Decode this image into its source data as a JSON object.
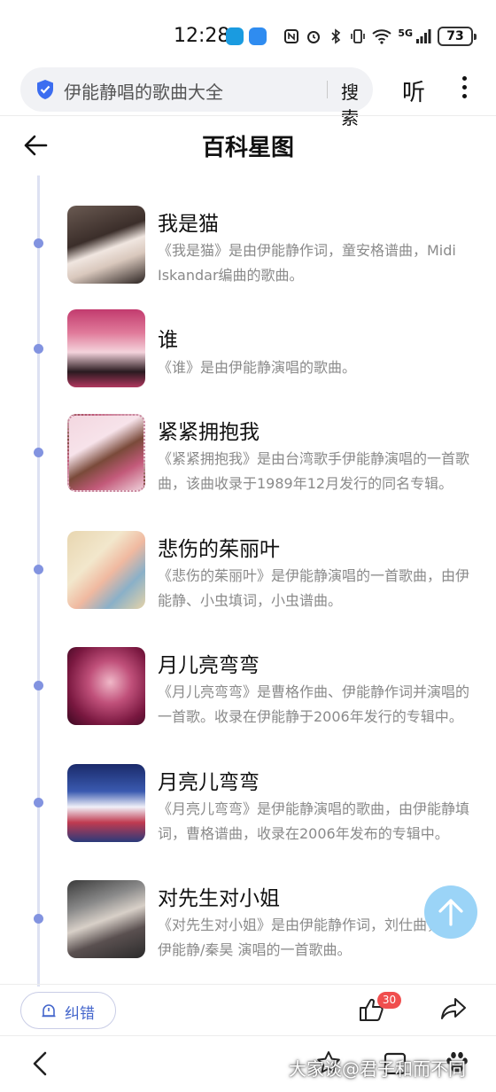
{
  "status_bar": {
    "time": "12:28",
    "battery": "73",
    "network": "5G"
  },
  "search": {
    "query": "伊能静唱的歌曲大全",
    "button_label": "搜索"
  },
  "toolbar": {
    "listen_label": "听"
  },
  "header": {
    "title": "百科星图"
  },
  "songs": [
    {
      "title": "我是猫",
      "desc": "《我是猫》是由伊能静作词，童安格谱曲，Midi Iskandar编曲的歌曲。"
    },
    {
      "title": "谁",
      "desc": "《谁》是由伊能静演唱的歌曲。"
    },
    {
      "title": "紧紧拥抱我",
      "desc": "《紧紧拥抱我》是由台湾歌手伊能静演唱的一首歌曲，该曲收录于1989年12月发行的同名专辑。"
    },
    {
      "title": "悲伤的茱丽叶",
      "desc": "《悲伤的茱丽叶》是伊能静演唱的一首歌曲，由伊能静、小虫填词，小虫谱曲。"
    },
    {
      "title": "月儿亮弯弯",
      "desc": "《月儿亮弯弯》是曹格作曲、伊能静作词并演唱的一首歌。收录在伊能静于2006年发行的专辑中。"
    },
    {
      "title": "月亮儿弯弯",
      "desc": "《月亮儿弯弯》是伊能静演唱的歌曲，由伊能静填词，曹格谱曲，收录在2006年发布的专辑中。"
    },
    {
      "title": "对先生对小姐",
      "desc": "《对先生对小姐》是由伊能静作词，刘仕曲， 歌手伊能静/秦昊 演唱的一首歌曲。"
    }
  ],
  "bottom_bar": {
    "feedback_label": "纠错",
    "like_count": "30"
  },
  "watermark": "大家谈@君子和而不同",
  "colors": {
    "accent": "#4466cc",
    "timeline_dot": "#8293e0",
    "badge": "#f04e4e",
    "to_top": "#9bd4f7"
  },
  "icons": {
    "search_shield": "shield-check-icon",
    "back": "arrow-left-icon",
    "like": "thumbs-up-icon",
    "share": "share-arrow-icon",
    "to_top": "arrow-up-icon"
  }
}
